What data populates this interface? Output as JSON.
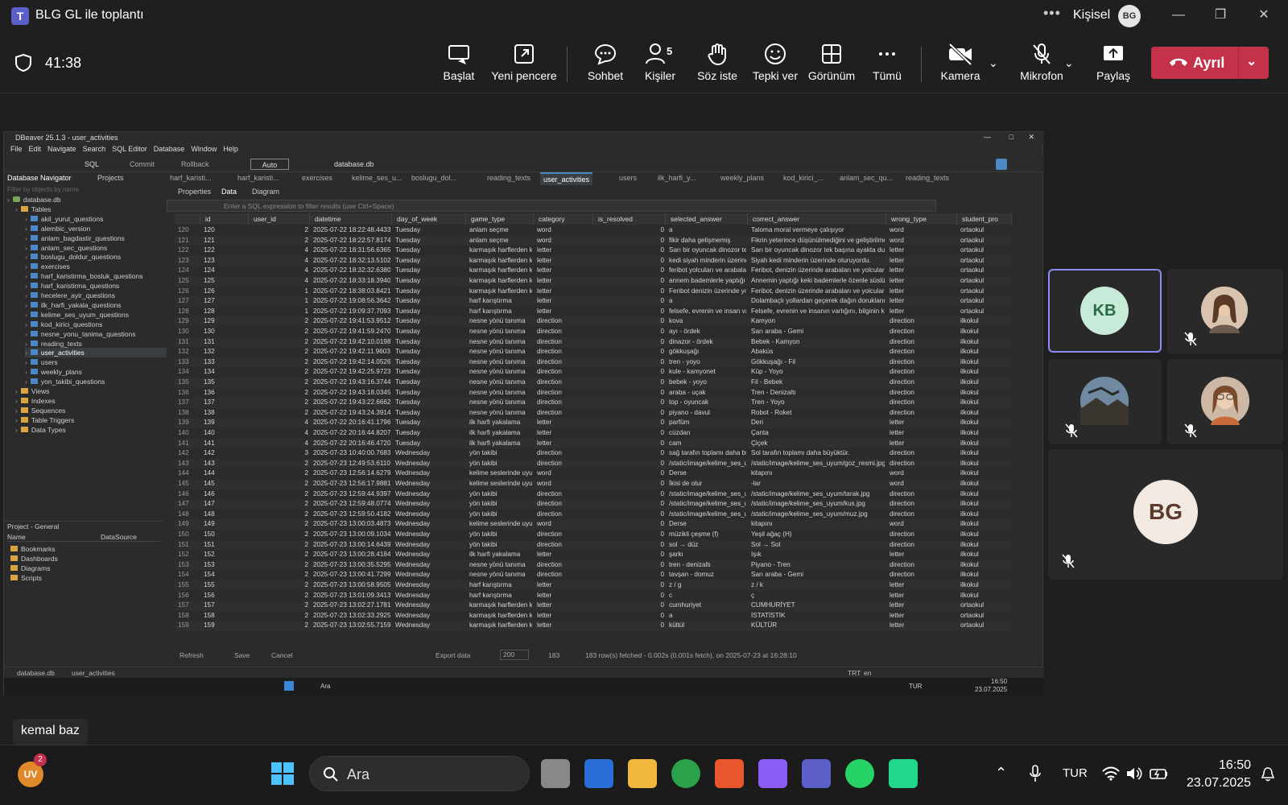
{
  "teams": {
    "title": "BLG GL ile toplantı",
    "profile_label": "Kişisel",
    "profile_initials": "BG",
    "timer": "41:38",
    "toolbar": {
      "start": "Başlat",
      "new_window": "Yeni pencere",
      "chat": "Sohbet",
      "people": "Kişiler",
      "people_count": "5",
      "raise_hand": "Söz iste",
      "react": "Tepki ver",
      "view": "Görünüm",
      "more": "Tümü",
      "camera": "Kamera",
      "mic": "Mikrofon",
      "share": "Paylaş",
      "leave": "Ayrıl"
    },
    "participants": [
      {
        "initials": "KB",
        "active": true
      },
      {
        "initials": "",
        "muted": true
      },
      {
        "initials": "",
        "muted": true
      },
      {
        "initials": "",
        "muted": true
      },
      {
        "initials": "BG",
        "muted": true
      }
    ],
    "presenter_name": "kemal baz"
  },
  "dbeaver": {
    "title": "DBeaver 25.1.3 - user_activities",
    "menu": [
      "File",
      "Edit",
      "Navigate",
      "Search",
      "SQL Editor",
      "Database",
      "Window",
      "Help"
    ],
    "toolbar": {
      "sql": "SQL",
      "commit": "Commit",
      "rollback": "Rollback",
      "mode": "Auto",
      "datasource": "database.db"
    },
    "nav_tabs": [
      "Database Navigator",
      "Projects"
    ],
    "nav_filter_placeholder": "Filter by objects by name",
    "tree": {
      "root": "database.db",
      "tables_label": "Tables",
      "tables": [
        "akil_yurut_questions",
        "alembic_version",
        "anlam_bagdastir_questions",
        "anlam_sec_questions",
        "boslugu_doldur_questions",
        "exercises",
        "harf_karistirma_bosluk_questions",
        "harf_karistirma_questions",
        "hecelere_ayir_questions",
        "ilk_harfi_yakala_questions",
        "kelime_ses_uyum_questions",
        "kod_kirici_questions",
        "nesne_yonu_tanima_questions",
        "reading_texts",
        "user_activities",
        "users",
        "weekly_plans",
        "yon_takibi_questions"
      ],
      "folders": [
        "Views",
        "Indexes",
        "Sequences",
        "Table Triggers",
        "Data Types"
      ]
    },
    "project": {
      "title": "Project - General",
      "columns": [
        "Name",
        "DataSource"
      ],
      "items": [
        "Bookmarks",
        "Dashboards",
        "Diagrams",
        "Scripts"
      ]
    },
    "editor_tabs": [
      "harf_karisti...",
      "harf_karisti...",
      "exercises",
      "kelime_ses_u...",
      "boslugu_dol...",
      "reading_texts",
      "user_activities",
      "users",
      "ilk_harfi_y...",
      "weekly_plans",
      "kod_kirici_...",
      "anlam_sec_qu...",
      "reading_texts"
    ],
    "sub_tabs": [
      "Properties",
      "Data",
      "Diagram"
    ],
    "filter_placeholder": "Enter a SQL expression to filter results (use Ctrl+Space)",
    "columns": [
      "id",
      "user_id",
      "datetime",
      "day_of_week",
      "game_type",
      "category",
      "is_resolved",
      "selected_answer",
      "correct_answer",
      "wrong_type",
      "student_pro"
    ],
    "rows": [
      [
        "120",
        "120",
        "2",
        "2025-07-22 18:22:48.443347",
        "Tuesday",
        "anlam seçme",
        "word",
        "0",
        "a",
        "Taloma moral vermeye çalışıyor",
        "word",
        "ortaokul"
      ],
      [
        "121",
        "121",
        "2",
        "2025-07-22 18:22:57.817421",
        "Tuesday",
        "anlam seçme",
        "word",
        "0",
        "fikir daha gelişmemiş",
        "Fikrin yeterince düşünülmediğini ve geliştirilme",
        "word",
        "ortaokul"
      ],
      [
        "122",
        "122",
        "4",
        "2025-07-22 18:31:56.636517",
        "Tuesday",
        "karmaşık harflerden keli",
        "letter",
        "0",
        "Sarı bir oyuncak dinozor tek t",
        "Sarı bir oyuncak dinozor tek başına ayakta duruy",
        "letter",
        "ortaokul"
      ],
      [
        "123",
        "123",
        "4",
        "2025-07-22 18:32:13.510250",
        "Tuesday",
        "karmaşık harflerden keli",
        "letter",
        "0",
        "kedi siyah minderin üzerinde",
        "Siyah kedi minderin üzerinde oturuyordu.",
        "letter",
        "ortaokul"
      ],
      [
        "124",
        "124",
        "4",
        "2025-07-22 18:32:32.638030",
        "Tuesday",
        "karmaşık harflerden keli",
        "letter",
        "0",
        "feribot yolcuları ve arabaları",
        "Feribot, denizin üzerinde arabaları ve yolcuları ta",
        "letter",
        "ortaokul"
      ],
      [
        "125",
        "125",
        "4",
        "2025-07-22 18:33:18.394082",
        "Tuesday",
        "karmaşık harflerden keli",
        "letter",
        "0",
        "annem bademlerle yaptığı ke",
        "Annemin yaptığı keki bademlerle özenle süslüyor",
        "letter",
        "ortaokul"
      ],
      [
        "126",
        "126",
        "1",
        "2025-07-22 18:38:03.842133",
        "Tuesday",
        "karmaşık harflerden keli",
        "letter",
        "0",
        "Feribot denizin üzerinde yolc",
        "Feribot, denizin üzerinde arabaları ve yolcuları ta",
        "letter",
        "ortaokul"
      ],
      [
        "127",
        "127",
        "1",
        "2025-07-22 19:08:56.364226",
        "Tuesday",
        "harf karıştırma",
        "letter",
        "0",
        "a",
        "Dolambaçlı yollardan geçerek dağın doruklarına",
        "letter",
        "ortaokul"
      ],
      [
        "128",
        "128",
        "1",
        "2025-07-22 19:09:37.709346",
        "Tuesday",
        "harf karıştırma",
        "letter",
        "0",
        "felsefe, evrenin ve insan va",
        "Felsefe, evrenin ve insanın varlığını, bilginin kay",
        "letter",
        "ortaokul"
      ],
      [
        "129",
        "129",
        "2",
        "2025-07-22 19:41:53.951290",
        "Tuesday",
        "nesne yönü tanıma",
        "direction",
        "0",
        "kova",
        "Kamyon",
        "direction",
        "ilkokul"
      ],
      [
        "130",
        "130",
        "2",
        "2025-07-22 19:41:59.247049",
        "Tuesday",
        "nesne yönü tanıma",
        "direction",
        "0",
        "ayı - ördek",
        "Sarı araba - Gemi",
        "direction",
        "ilkokul"
      ],
      [
        "131",
        "131",
        "2",
        "2025-07-22 19:42:10.019829",
        "Tuesday",
        "nesne yönü tanıma",
        "direction",
        "0",
        "dinazor - ördek",
        "Bebek - Kamyon",
        "direction",
        "ilkokul"
      ],
      [
        "132",
        "132",
        "2",
        "2025-07-22 19:42:11.960342",
        "Tuesday",
        "nesne yönü tanıma",
        "direction",
        "0",
        "gökkuşağı",
        "Abaküs",
        "direction",
        "ilkokul"
      ],
      [
        "133",
        "133",
        "2",
        "2025-07-22 19:42:14.052691",
        "Tuesday",
        "nesne yönü tanıma",
        "direction",
        "0",
        "tren - yoyo",
        "Gökkuşağı - Fil",
        "direction",
        "ilkokul"
      ],
      [
        "134",
        "134",
        "2",
        "2025-07-22 19:42:25.972329",
        "Tuesday",
        "nesne yönü tanıma",
        "direction",
        "0",
        "kule - kamyonet",
        "Küp - Yoyo",
        "direction",
        "ilkokul"
      ],
      [
        "135",
        "135",
        "2",
        "2025-07-22 19:43:16.374439",
        "Tuesday",
        "nesne yönü tanıma",
        "direction",
        "0",
        "bebek - yoyo",
        "Fil - Bebek",
        "direction",
        "ilkokul"
      ],
      [
        "136",
        "136",
        "2",
        "2025-07-22 19:43:18.034599",
        "Tuesday",
        "nesne yönü tanıma",
        "direction",
        "0",
        "araba - uçak",
        "Tren - Denizaltı",
        "direction",
        "ilkokul"
      ],
      [
        "137",
        "137",
        "2",
        "2025-07-22 19:43:22.666250",
        "Tuesday",
        "nesne yönü tanıma",
        "direction",
        "0",
        "top - oyuncak",
        "Tren - Yoyo",
        "direction",
        "ilkokul"
      ],
      [
        "138",
        "138",
        "2",
        "2025-07-22 19:43:24.391448",
        "Tuesday",
        "nesne yönü tanıma",
        "direction",
        "0",
        "piyano - davul",
        "Robot - Roket",
        "direction",
        "ilkokul"
      ],
      [
        "139",
        "139",
        "4",
        "2025-07-22 20:16:41.179611",
        "Tuesday",
        "ilk harfi yakalama",
        "letter",
        "0",
        "parfüm",
        "Deri",
        "letter",
        "ilkokul"
      ],
      [
        "140",
        "140",
        "4",
        "2025-07-22 20:16:44.820737",
        "Tuesday",
        "ilk harfi yakalama",
        "letter",
        "0",
        "cüzdan",
        "Çanta",
        "letter",
        "ilkokul"
      ],
      [
        "141",
        "141",
        "4",
        "2025-07-22 20:16:46.472038",
        "Tuesday",
        "ilk harfi yakalama",
        "letter",
        "0",
        "cam",
        "Çiçek",
        "letter",
        "ilkokul"
      ],
      [
        "142",
        "142",
        "3",
        "2025-07-23 10:40:00.768392",
        "Wednesday",
        "yön takibi",
        "direction",
        "0",
        "sağ tarafın toplamı daha büy",
        "Sol tarafın toplamı daha büyüktür.",
        "direction",
        "ilkokul"
      ],
      [
        "143",
        "143",
        "2",
        "2025-07-23 12:49:53.611033",
        "Wednesday",
        "yön takibi",
        "direction",
        "0",
        "/static/image/kelime_ses_uy",
        "/static/image/kelime_ses_uyum/goz_resmi.jpg",
        "direction",
        "ilkokul"
      ],
      [
        "144",
        "144",
        "2",
        "2025-07-23 12:56:14.627923",
        "Wednesday",
        "kelime seslerinde uyum",
        "word",
        "0",
        "Derse",
        "kitapını",
        "word",
        "ilkokul"
      ],
      [
        "145",
        "145",
        "2",
        "2025-07-23 12:56:17.988135",
        "Wednesday",
        "kelime seslerinde uyum",
        "word",
        "0",
        "İkisi de olur",
        "-lar",
        "word",
        "ilkokul"
      ],
      [
        "146",
        "146",
        "2",
        "2025-07-23 12:59:44.939759",
        "Wednesday",
        "yön takibi",
        "direction",
        "0",
        "/static/image/kelime_ses_uy",
        "/static/image/kelime_ses_uyum/tarak.jpg",
        "direction",
        "ilkokul"
      ],
      [
        "147",
        "147",
        "2",
        "2025-07-23 12:59:48.077451",
        "Wednesday",
        "yön takibi",
        "direction",
        "0",
        "/static/image/kelime_ses_uy",
        "/static/image/kelime_ses_uyum/kus.jpg",
        "direction",
        "ilkokul"
      ],
      [
        "148",
        "148",
        "2",
        "2025-07-23 12:59:50.418223",
        "Wednesday",
        "yön takibi",
        "direction",
        "0",
        "/static/image/kelime_ses_uy",
        "/static/image/kelime_ses_uyum/muz.jpg",
        "direction",
        "ilkokul"
      ],
      [
        "149",
        "149",
        "2",
        "2025-07-23 13:00:03.487378",
        "Wednesday",
        "kelime seslerinde uyum",
        "word",
        "0",
        "Derse",
        "kitapını",
        "word",
        "ilkokul"
      ],
      [
        "150",
        "150",
        "2",
        "2025-07-23 13:00:09.103481",
        "Wednesday",
        "yön takibi",
        "direction",
        "0",
        "müzikli çeşme (f)",
        "Yeşil ağaç (H)",
        "direction",
        "ilkokul"
      ],
      [
        "151",
        "151",
        "2",
        "2025-07-23 13:00:14.643958",
        "Wednesday",
        "yön takibi",
        "direction",
        "0",
        "sol → düz",
        "Sol → Sol",
        "direction",
        "ilkokul"
      ],
      [
        "152",
        "152",
        "2",
        "2025-07-23 13:00:28.418460",
        "Wednesday",
        "ilk harfi yakalama",
        "letter",
        "0",
        "şarkı",
        "Işık",
        "letter",
        "ilkokul"
      ],
      [
        "153",
        "153",
        "2",
        "2025-07-23 13:00:35.529578",
        "Wednesday",
        "nesne yönü tanıma",
        "direction",
        "0",
        "tren - denizaltı",
        "Piyano - Tren",
        "direction",
        "ilkokul"
      ],
      [
        "154",
        "154",
        "2",
        "2025-07-23 13:00:41.729923",
        "Wednesday",
        "nesne yönü tanıma",
        "direction",
        "0",
        "tavşan - domuz",
        "Sarı araba - Gemi",
        "direction",
        "ilkokul"
      ],
      [
        "155",
        "155",
        "2",
        "2025-07-23 13:00:58.950565",
        "Wednesday",
        "harf karıştırma",
        "letter",
        "0",
        "z / g",
        "z / k",
        "letter",
        "ilkokul"
      ],
      [
        "156",
        "156",
        "2",
        "2025-07-23 13:01:09.341307",
        "Wednesday",
        "harf karıştırma",
        "letter",
        "0",
        "c",
        "ç",
        "letter",
        "ilkokul"
      ],
      [
        "157",
        "157",
        "2",
        "2025-07-23 13:02:27.178162",
        "Wednesday",
        "karmaşık harflerden keli",
        "letter",
        "0",
        "cumhuriyet",
        "CUMHURİYET",
        "letter",
        "ortaokul"
      ],
      [
        "158",
        "158",
        "2",
        "2025-07-23 13:02:33.292577",
        "Wednesday",
        "karmaşık harflerden keli",
        "letter",
        "0",
        "a",
        "İSTATİSTİK",
        "letter",
        "ortaokul"
      ],
      [
        "159",
        "159",
        "2",
        "2025-07-23 13:02:55.715960",
        "Wednesday",
        "karmaşık harflerden keli",
        "letter",
        "0",
        "kültül",
        "KÜLTÜR",
        "letter",
        "ortaokul"
      ]
    ],
    "status": {
      "refresh": "Refresh",
      "save": "Save",
      "cancel": "Cancel",
      "export": "Export data",
      "limit": "200",
      "count": "183",
      "message": "183 row(s) fetched - 0.002s (0.001s fetch), on 2025-07-23 at 16:28:10"
    },
    "footer": {
      "db": "database.db",
      "table": "user_activities",
      "tz": "TRT",
      "lang": "en"
    },
    "rdp_taskbar": {
      "search": "Ara",
      "lang": "TUR",
      "time": "16:50",
      "date": "23.07.2025"
    }
  },
  "taskbar": {
    "search": "Ara",
    "lang": "TUR",
    "time": "16:50",
    "date": "23.07.2025",
    "badge": "2"
  }
}
